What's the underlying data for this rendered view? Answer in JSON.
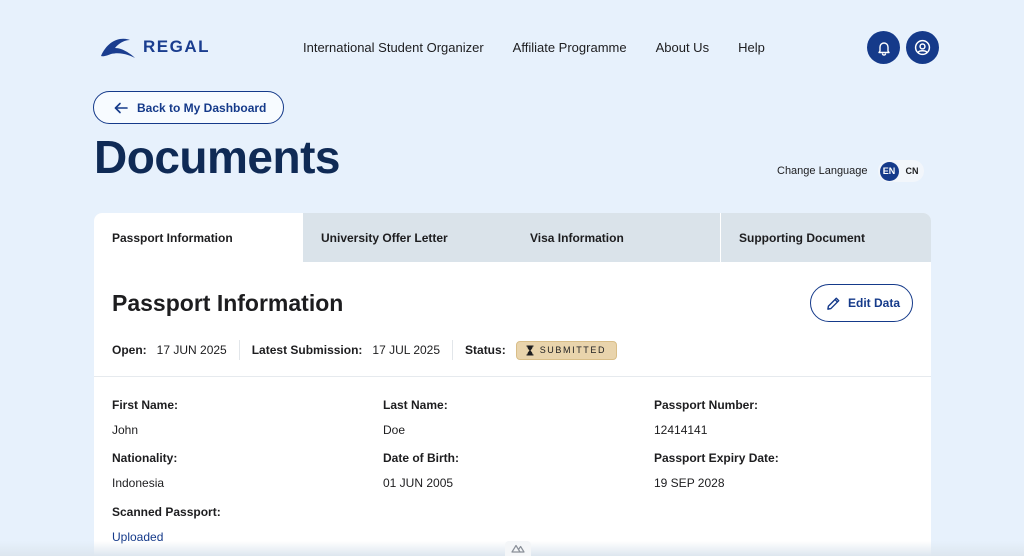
{
  "brand": {
    "name": "REGAL",
    "accent": "#153a8a",
    "title_color": "#0f2a55"
  },
  "nav": {
    "items": [
      {
        "label": "International Student Organizer"
      },
      {
        "label": "Affiliate Programme"
      },
      {
        "label": "About Us"
      },
      {
        "label": "Help"
      }
    ],
    "notifications_icon": "bell-icon",
    "profile_icon": "user-circle-icon"
  },
  "back_button": {
    "label": "Back to My Dashboard",
    "icon": "arrow-left-icon"
  },
  "page": {
    "title": "Documents"
  },
  "language": {
    "label": "Change Language",
    "options": [
      "EN",
      "CN"
    ],
    "selected": "EN"
  },
  "tabs": [
    {
      "label": "Passport Information",
      "active": true
    },
    {
      "label": "University Offer Letter",
      "active": false
    },
    {
      "label": "Visa Information",
      "active": false
    },
    {
      "label": "Supporting Document",
      "active": false
    }
  ],
  "section": {
    "title": "Passport Information",
    "edit_label": "Edit Data",
    "edit_icon": "pencil-icon",
    "open_label": "Open:",
    "open_value": "17 JUN 2025",
    "latest_label": "Latest Submission:",
    "latest_value": "17 JUL 2025",
    "status_label": "Status:",
    "status_value": "SUBMITTED",
    "status_icon": "hourglass-icon",
    "status_color": "#e9d4ac"
  },
  "fields": {
    "first_name": {
      "label": "First Name:",
      "value": "John"
    },
    "last_name": {
      "label": "Last Name:",
      "value": "Doe"
    },
    "passport_number": {
      "label": "Passport Number:",
      "value": "12414141"
    },
    "nationality": {
      "label": "Nationality:",
      "value": "Indonesia"
    },
    "date_of_birth": {
      "label": "Date of Birth:",
      "value": "01 JUN 2005"
    },
    "passport_expiry": {
      "label": "Passport Expiry Date:",
      "value": "19 SEP 2028"
    },
    "scanned_passport": {
      "label": "Scanned Passport:",
      "value": "Uploaded"
    }
  }
}
